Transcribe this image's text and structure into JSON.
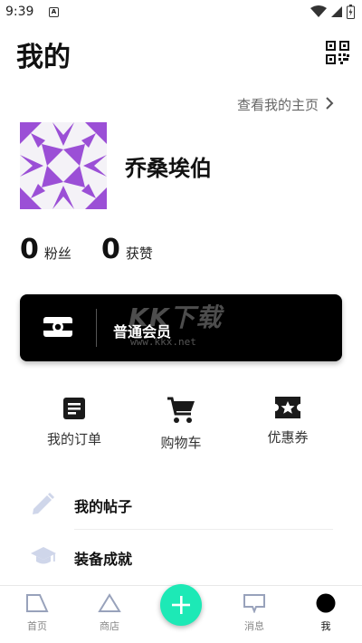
{
  "status": {
    "time": "9:39",
    "notif": "A"
  },
  "header": {
    "title": "我的"
  },
  "profile": {
    "homepage_link": "查看我的主页",
    "username": "乔桑埃伯",
    "fans_count": "0",
    "fans_label": "粉丝",
    "likes_count": "0",
    "likes_label": "获赞"
  },
  "membership": {
    "label": "普通会员",
    "watermark": "KK下载",
    "watermark_url": "www.kkx.net"
  },
  "quick_actions": [
    {
      "label": "我的订单",
      "icon": "order-icon"
    },
    {
      "label": "购物车",
      "icon": "cart-icon"
    },
    {
      "label": "优惠券",
      "icon": "coupon-icon"
    }
  ],
  "menu": [
    {
      "label": "我的帖子",
      "icon": "pencil-icon"
    },
    {
      "label": "装备成就",
      "icon": "graduation-cap-icon"
    }
  ],
  "bottom_nav": [
    {
      "label": "首页",
      "icon": "home-icon"
    },
    {
      "label": "商店",
      "icon": "shop-icon"
    },
    {
      "label": "消息",
      "icon": "message-icon"
    },
    {
      "label": "我",
      "icon": "profile-icon"
    }
  ],
  "colors": {
    "accent": "#1de9b6",
    "avatar": "#9b4fd6",
    "card": "#000000"
  }
}
